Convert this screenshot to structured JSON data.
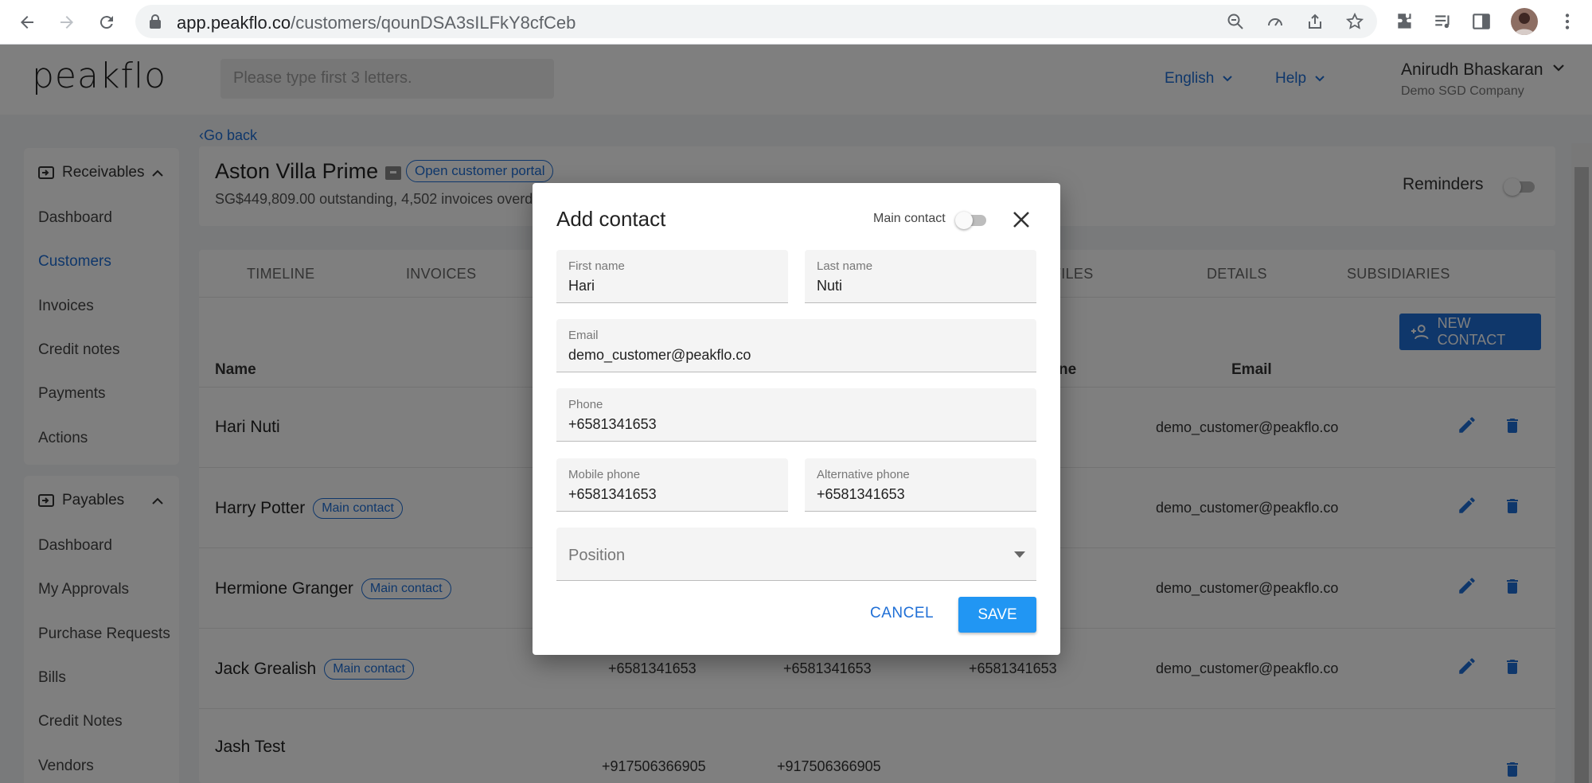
{
  "browser": {
    "url_host": "app.peakflo.co",
    "url_path": "/customers/qounDSA3sILFkY8cfCeb"
  },
  "app": {
    "logo": "peakflo",
    "search_placeholder": "Please type first 3 letters.",
    "language": "English",
    "help": "Help",
    "user_name": "Anirudh Bhaskaran",
    "company": "Demo SGD Company"
  },
  "sidebar": {
    "receivables_label": "Receivables",
    "receivables_items": [
      "Dashboard",
      "Customers",
      "Invoices",
      "Credit notes",
      "Payments",
      "Actions"
    ],
    "payables_label": "Payables",
    "payables_items": [
      "Dashboard",
      "My Approvals",
      "Purchase Requests",
      "Bills",
      "Credit Notes",
      "Vendors"
    ]
  },
  "customer": {
    "go_back": "Go back",
    "name": "Aston Villa Prime",
    "portal_chip": "Open customer portal",
    "summary": "SG$449,809.00 outstanding, 4,502 invoices overd",
    "reminders_label": "Reminders"
  },
  "tabs": [
    "TIMELINE",
    "INVOICES",
    "FILES",
    "DETAILS",
    "SUBSIDIARIES"
  ],
  "contacts": {
    "new_button": "NEW CONTACT",
    "headers": {
      "name": "Name",
      "phone_partial": "ne",
      "email": "Email"
    },
    "main_chip": "Main contact",
    "rows": [
      {
        "name": "Hari Nuti",
        "main": false,
        "phone": "",
        "mobile": "",
        "alt": "",
        "email": "demo_customer@peakflo.co"
      },
      {
        "name": "Harry Potter",
        "main": true,
        "phone": "",
        "mobile": "",
        "alt": "",
        "email": "demo_customer@peakflo.co"
      },
      {
        "name": "Hermione Granger",
        "main": true,
        "phone": "",
        "mobile": "",
        "alt": "",
        "email": "demo_customer@peakflo.co"
      },
      {
        "name": "Jack Grealish",
        "main": true,
        "phone": "+6581341653",
        "mobile": "+6581341653",
        "alt": "+6581341653",
        "email": "demo_customer@peakflo.co"
      },
      {
        "name": "Jash Test",
        "main": false,
        "phone": "+917506366905",
        "mobile": "+917506366905",
        "alt": "",
        "email": ""
      }
    ]
  },
  "dialog": {
    "title": "Add contact",
    "main_contact_label": "Main contact",
    "first_name": {
      "label": "First name",
      "value": "Hari"
    },
    "last_name": {
      "label": "Last name",
      "value": "Nuti"
    },
    "email": {
      "label": "Email",
      "value": "demo_customer@peakflo.co"
    },
    "phone": {
      "label": "Phone",
      "value": "+6581341653"
    },
    "mobile_phone": {
      "label": "Mobile phone",
      "value": "+6581341653"
    },
    "alternative_phone": {
      "label": "Alternative phone",
      "value": "+6581341653"
    },
    "position": {
      "placeholder": "Position"
    },
    "cancel": "CANCEL",
    "save": "SAVE"
  },
  "colors": {
    "accent": "#1f6fd6",
    "save": "#2196f3"
  }
}
